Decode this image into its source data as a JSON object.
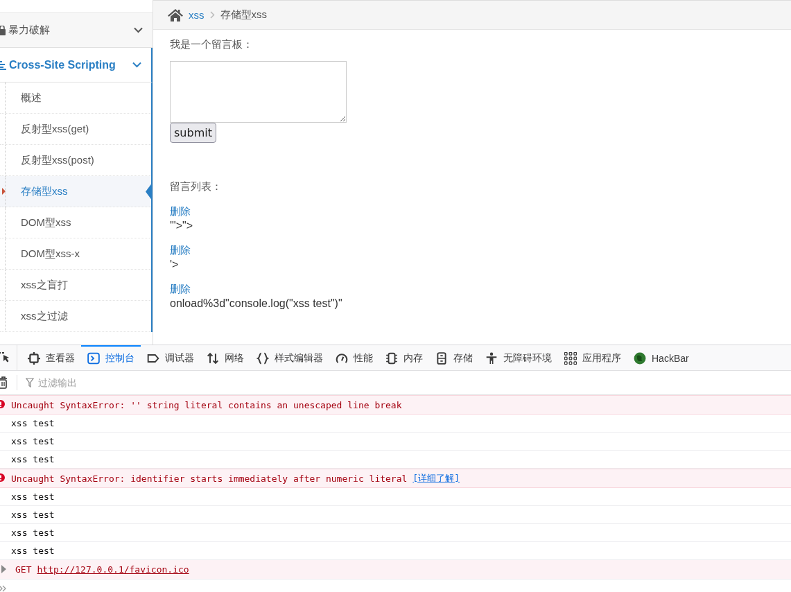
{
  "sidebar": {
    "groups": [
      {
        "label": "暴力破解",
        "selected": false,
        "kind": "lock"
      },
      {
        "label": "Cross-Site Scripting",
        "selected": true,
        "kind": "list",
        "children": [
          {
            "label": "概述",
            "selected": false
          },
          {
            "label": "反射型xss(get)",
            "selected": false
          },
          {
            "label": "反射型xss(post)",
            "selected": false
          },
          {
            "label": "存储型xss",
            "selected": true
          },
          {
            "label": "DOM型xss",
            "selected": false
          },
          {
            "label": "DOM型xss-x",
            "selected": false
          },
          {
            "label": "xss之盲打",
            "selected": false
          },
          {
            "label": "xss之过滤",
            "selected": false
          }
        ]
      }
    ]
  },
  "breadcrumb": [
    "xss",
    "存储型xss"
  ],
  "form": {
    "label": "我是一个留言板：",
    "button": "submit"
  },
  "messages": {
    "label": "留言列表：",
    "items": [
      {
        "action": "删除",
        "text": "'\">\">"
      },
      {
        "action": "删除",
        "text": "'>"
      },
      {
        "action": "删除",
        "text": "onload%3d\"console.log(\"xss test\")\""
      }
    ]
  },
  "devtools": {
    "tabs": [
      {
        "label": "查看器",
        "kind": "inspector",
        "selected": false
      },
      {
        "label": "控制台",
        "kind": "console",
        "selected": true
      },
      {
        "label": "调试器",
        "kind": "debugger",
        "selected": false
      },
      {
        "label": "网络",
        "kind": "network",
        "selected": false
      },
      {
        "label": "样式编辑器",
        "kind": "style",
        "selected": false
      },
      {
        "label": "性能",
        "kind": "performance",
        "selected": false
      },
      {
        "label": "内存",
        "kind": "memory",
        "selected": false
      },
      {
        "label": "存储",
        "kind": "storage",
        "selected": false
      },
      {
        "label": "无障碍环境",
        "kind": "accessibility",
        "selected": false
      },
      {
        "label": "应用程序",
        "kind": "application",
        "selected": false
      },
      {
        "label": "HackBar",
        "kind": "hackbar",
        "selected": false
      }
    ],
    "filter": {
      "placeholder": "过滤输出"
    },
    "console": [
      {
        "kind": "error",
        "text": "Uncaught SyntaxError: '' string literal contains an unescaped line break"
      },
      {
        "kind": "log",
        "text": "xss test"
      },
      {
        "kind": "log",
        "text": "xss test"
      },
      {
        "kind": "log",
        "text": "xss test"
      },
      {
        "kind": "error",
        "text": "Uncaught SyntaxError: identifier starts immediately after numeric literal",
        "link": "[详细了解]"
      },
      {
        "kind": "log",
        "text": "xss test"
      },
      {
        "kind": "log",
        "text": "xss test"
      },
      {
        "kind": "log",
        "text": "xss test"
      },
      {
        "kind": "log",
        "text": "xss test"
      },
      {
        "kind": "network",
        "method": "GET",
        "url": "http://127.0.0.1/favicon.ico"
      }
    ]
  }
}
